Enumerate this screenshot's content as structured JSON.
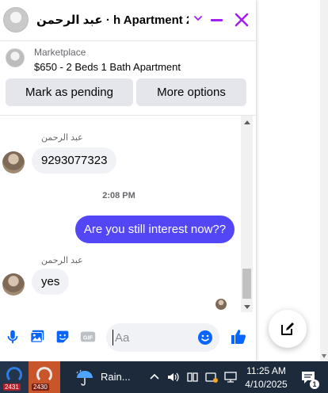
{
  "header": {
    "title": "عبد الرحمن · h Apartment 2…",
    "minimize_label": "",
    "close_label": ""
  },
  "listing": {
    "source": "Marketplace",
    "title": "$650 - 2 Beds 1 Bath Apartment",
    "mark_pending_label": "Mark as pending",
    "more_options_label": "More options"
  },
  "messages": {
    "first_sender": "عبد الرحمن",
    "first_message": "9293077323",
    "timestamp": "2:08 PM",
    "outgoing_message": "Are you still interest now??",
    "second_sender": "عبد الرحمن",
    "second_message": "yes"
  },
  "composer": {
    "placeholder": "Aa"
  },
  "taskbar": {
    "app1_badge": "2431",
    "app2_badge": "2430",
    "weather_label": "Rain...",
    "time": "11:25 AM",
    "date": "4/10/2025",
    "notification_count": "1"
  },
  "colors": {
    "accent_purple": "#a020f0",
    "outgoing_bubble": "#5346f5",
    "icon_blue": "#0866ff"
  }
}
